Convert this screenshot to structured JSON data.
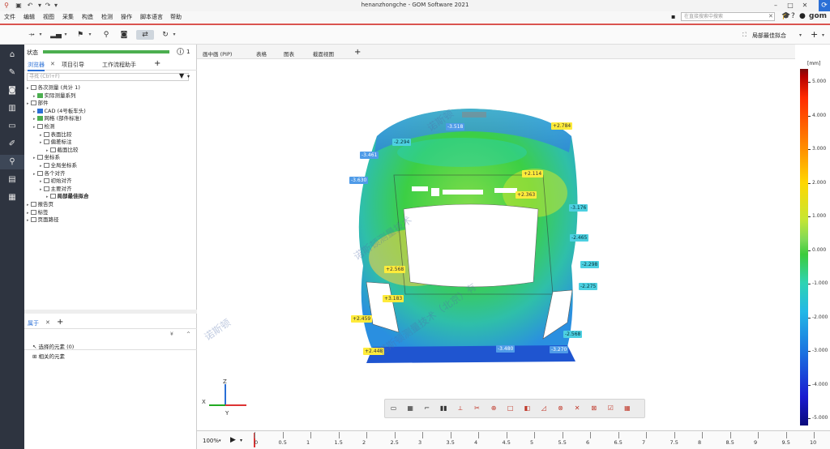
{
  "window": {
    "title": "henanzhongche - GOM Software 2021"
  },
  "menu": [
    "文件",
    "编辑",
    "视图",
    "采集",
    "构造",
    "检测",
    "操作",
    "脚本语言",
    "帮助"
  ],
  "search": {
    "placeholder": "在直接搜索中搜索"
  },
  "toolbar": {
    "fit_mode": "局部最佳拟合"
  },
  "leftbar": {
    "items": [
      "home-icon",
      "wrench-icon",
      "camera-icon",
      "barcode-icon",
      "display-icon",
      "brush-icon",
      "search-icon",
      "report-icon",
      "grid-icon"
    ]
  },
  "status": {
    "label": "状态",
    "count": "1"
  },
  "panel": {
    "tabs": [
      "浏览器",
      "项目引导",
      "工作流程助手"
    ],
    "search_placeholder": "寻找 (Ctrl+F)",
    "tree": [
      {
        "text": "各次测量 (共计 1)",
        "indent": 0
      },
      {
        "text": "实际测量系列",
        "indent": 1
      },
      {
        "text": "部件",
        "indent": 0
      },
      {
        "text": "CAD (4号板车头)",
        "indent": 1
      },
      {
        "text": "网格 (部件标准)",
        "indent": 1
      },
      {
        "text": "检测",
        "indent": 1
      },
      {
        "text": "表面比较",
        "indent": 2
      },
      {
        "text": "偏差标注",
        "indent": 2
      },
      {
        "text": "截面比较",
        "indent": 3
      },
      {
        "text": "坐标系",
        "indent": 1
      },
      {
        "text": "全局坐标系",
        "indent": 2
      },
      {
        "text": "各个对齐",
        "indent": 1
      },
      {
        "text": "初始对齐",
        "indent": 2
      },
      {
        "text": "主要对齐",
        "indent": 2
      },
      {
        "text": "局部最佳拟合",
        "indent": 3
      },
      {
        "text": "报告页",
        "indent": 0
      },
      {
        "text": "标签",
        "indent": 0
      },
      {
        "text": "页面路径",
        "indent": 0
      }
    ]
  },
  "properties": {
    "tab": "属于",
    "rows": [
      "选择的元素 (0)",
      "相关的元素"
    ]
  },
  "view": {
    "tabs": [
      "画中画 (PIP)",
      "表格",
      "图表",
      "截面视图"
    ],
    "zoom": "100%"
  },
  "labels": [
    {
      "text": "-3.518",
      "kind": "b"
    },
    {
      "text": "+2.784",
      "kind": "y"
    },
    {
      "text": "-2.294",
      "kind": "c"
    },
    {
      "text": "-3.461",
      "kind": "b"
    },
    {
      "text": "-3.630",
      "kind": "b"
    },
    {
      "text": "+2.114",
      "kind": "y"
    },
    {
      "text": "+2.363",
      "kind": "y"
    },
    {
      "text": "-3.176",
      "kind": "c"
    },
    {
      "text": "-2.465",
      "kind": "c"
    },
    {
      "text": "-2.298",
      "kind": "c"
    },
    {
      "text": "-2.275",
      "kind": "c"
    },
    {
      "text": "+2.568",
      "kind": "y"
    },
    {
      "text": "+3.183",
      "kind": "y"
    },
    {
      "text": "+2.459",
      "kind": "y"
    },
    {
      "text": "-2.568",
      "kind": "c"
    },
    {
      "text": "+2.448",
      "kind": "y"
    },
    {
      "text": "-3.480",
      "kind": "b"
    },
    {
      "text": "-3.270",
      "kind": "b"
    }
  ],
  "watermarks": [
    "诺斯顿测量技术（北京）有",
    "诺斯顿测量技术",
    "诺斯顿"
  ],
  "scale": {
    "unit": "[mm]",
    "ticks": [
      "5.000",
      "4.000",
      "3.000",
      "2.000",
      "1.000",
      "0.000",
      "-1.000",
      "-2.000",
      "-3.000",
      "-4.000",
      "-5.000"
    ]
  },
  "timeline": {
    "marks": [
      "0",
      "0.5",
      "1",
      "1.5",
      "2",
      "2.5",
      "3",
      "3.5",
      "4",
      "4.5",
      "5",
      "5.5",
      "6",
      "6.5",
      "7",
      "7.5",
      "8",
      "8.5",
      "9",
      "9.5",
      "10"
    ]
  },
  "triad": {
    "z": "Z",
    "x": "X",
    "y": "Y"
  },
  "colors": {
    "accent": "#2a6fd6",
    "progress": "#4caf50",
    "brand_red": "#d9534f"
  }
}
